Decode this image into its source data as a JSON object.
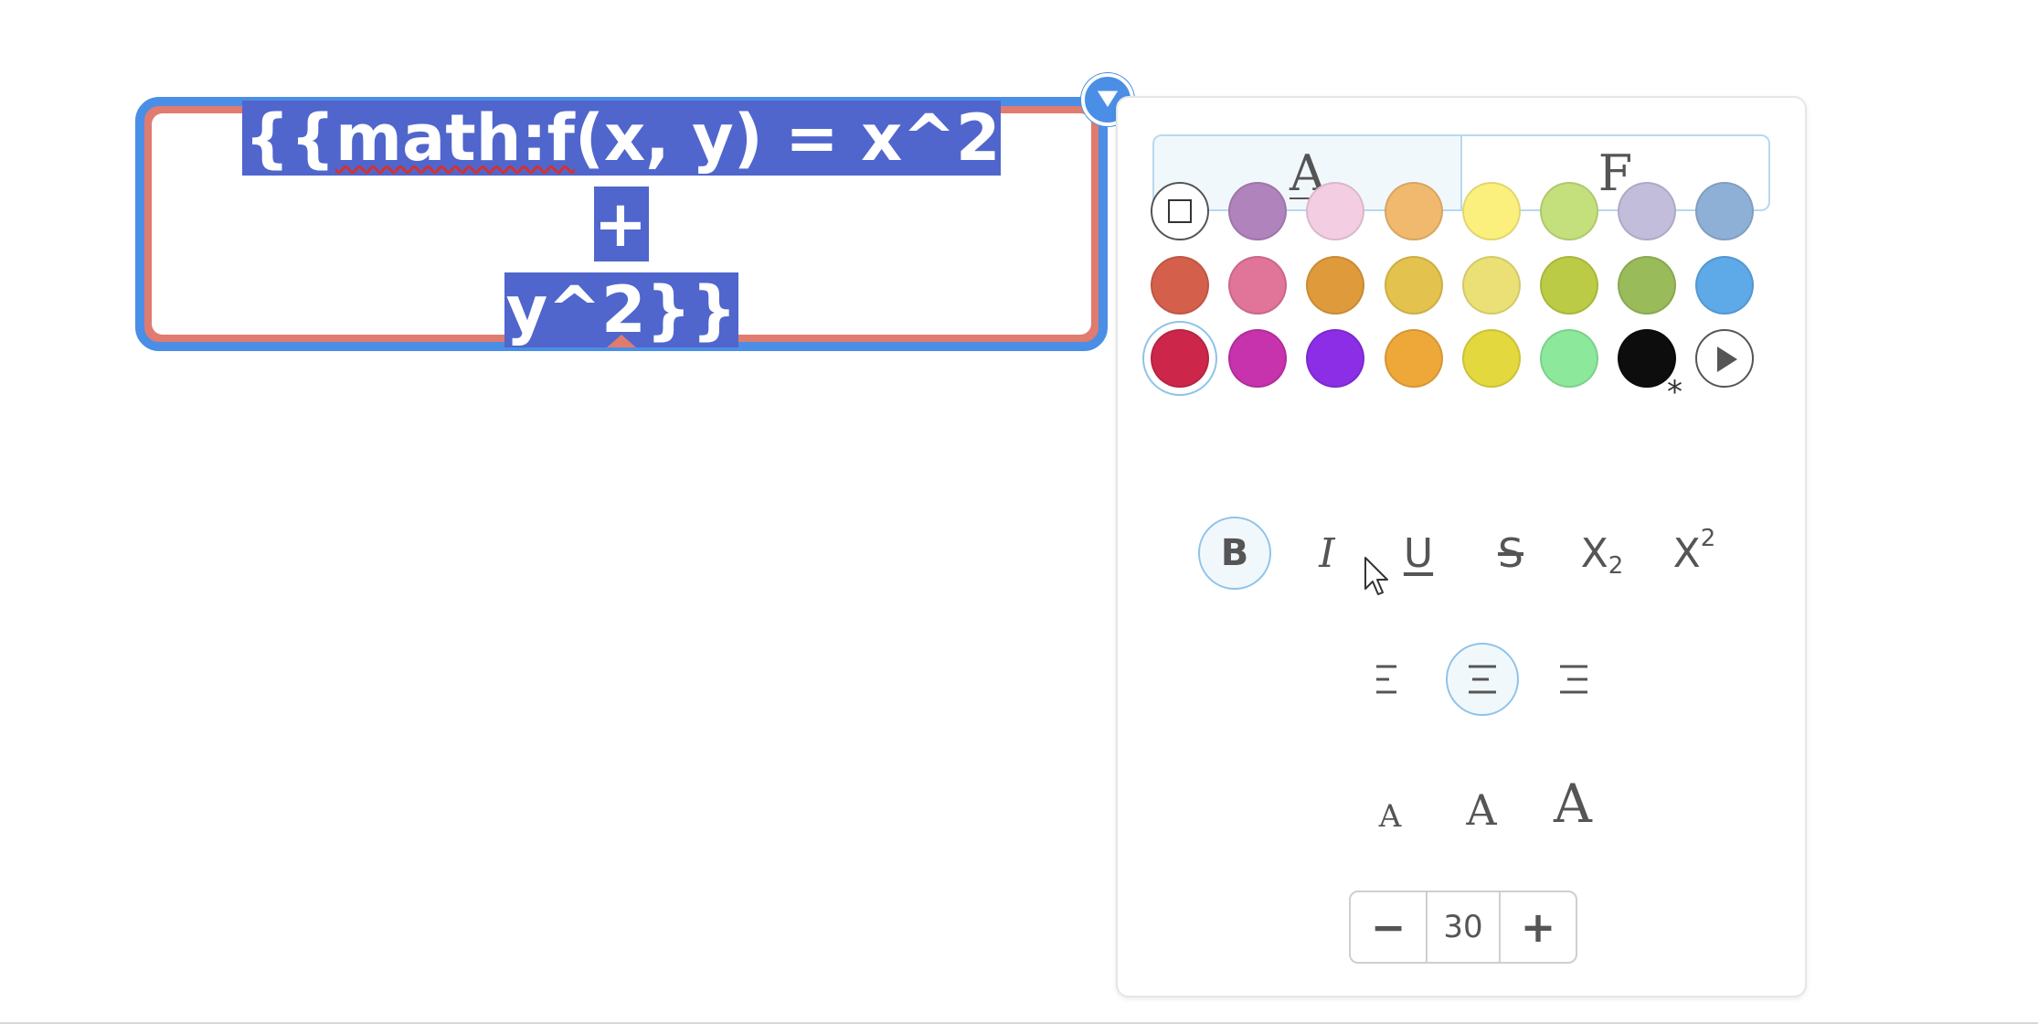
{
  "node": {
    "text_line1": "{{math:f(x, y) = x^2 + ",
    "text_line2": "y^2}}",
    "squiggle_word": "math:f",
    "border_color": "#e07b6f",
    "selection_color": "#5066cc",
    "focus_color": "#4b8ee6"
  },
  "panel": {
    "tabs": [
      {
        "label": "A",
        "active": true
      },
      {
        "label": "F",
        "active": false
      }
    ],
    "colors": [
      [
        "none",
        "#b083bd",
        "#f3cde2",
        "#f0b96e",
        "#fbef7d",
        "#c3e07c",
        "#c3bddc",
        "#8fb0d6"
      ],
      [
        "#d4604b",
        "#e07499",
        "#df9b3b",
        "#e3c24e",
        "#ebe075",
        "#bccb45",
        "#99bb5a",
        "#5ea9e8"
      ],
      [
        "#cc274a",
        "#c633ac",
        "#8c2ee6",
        "#eea83a",
        "#e3d83e",
        "#8ce89b",
        "#0d0d0d",
        "more"
      ]
    ],
    "selected_color": "#cc274a",
    "default_color_marker": "*",
    "format_buttons": [
      {
        "label": "B",
        "name": "bold",
        "active": true
      },
      {
        "label": "I",
        "name": "italic",
        "active": false
      },
      {
        "label": "U",
        "name": "underline",
        "active": false
      },
      {
        "label": "S",
        "name": "strikethrough",
        "active": false
      },
      {
        "label": "X",
        "sub": "2",
        "name": "subscript",
        "active": false
      },
      {
        "label": "X",
        "sup": "2",
        "name": "superscript",
        "active": false
      }
    ],
    "align_buttons": [
      {
        "name": "align-left",
        "active": false
      },
      {
        "name": "align-center",
        "active": true
      },
      {
        "name": "align-right",
        "active": false
      }
    ],
    "size_buttons": [
      "A",
      "A",
      "A"
    ],
    "font_size": {
      "minus": "−",
      "value": "30",
      "plus": "+"
    }
  }
}
